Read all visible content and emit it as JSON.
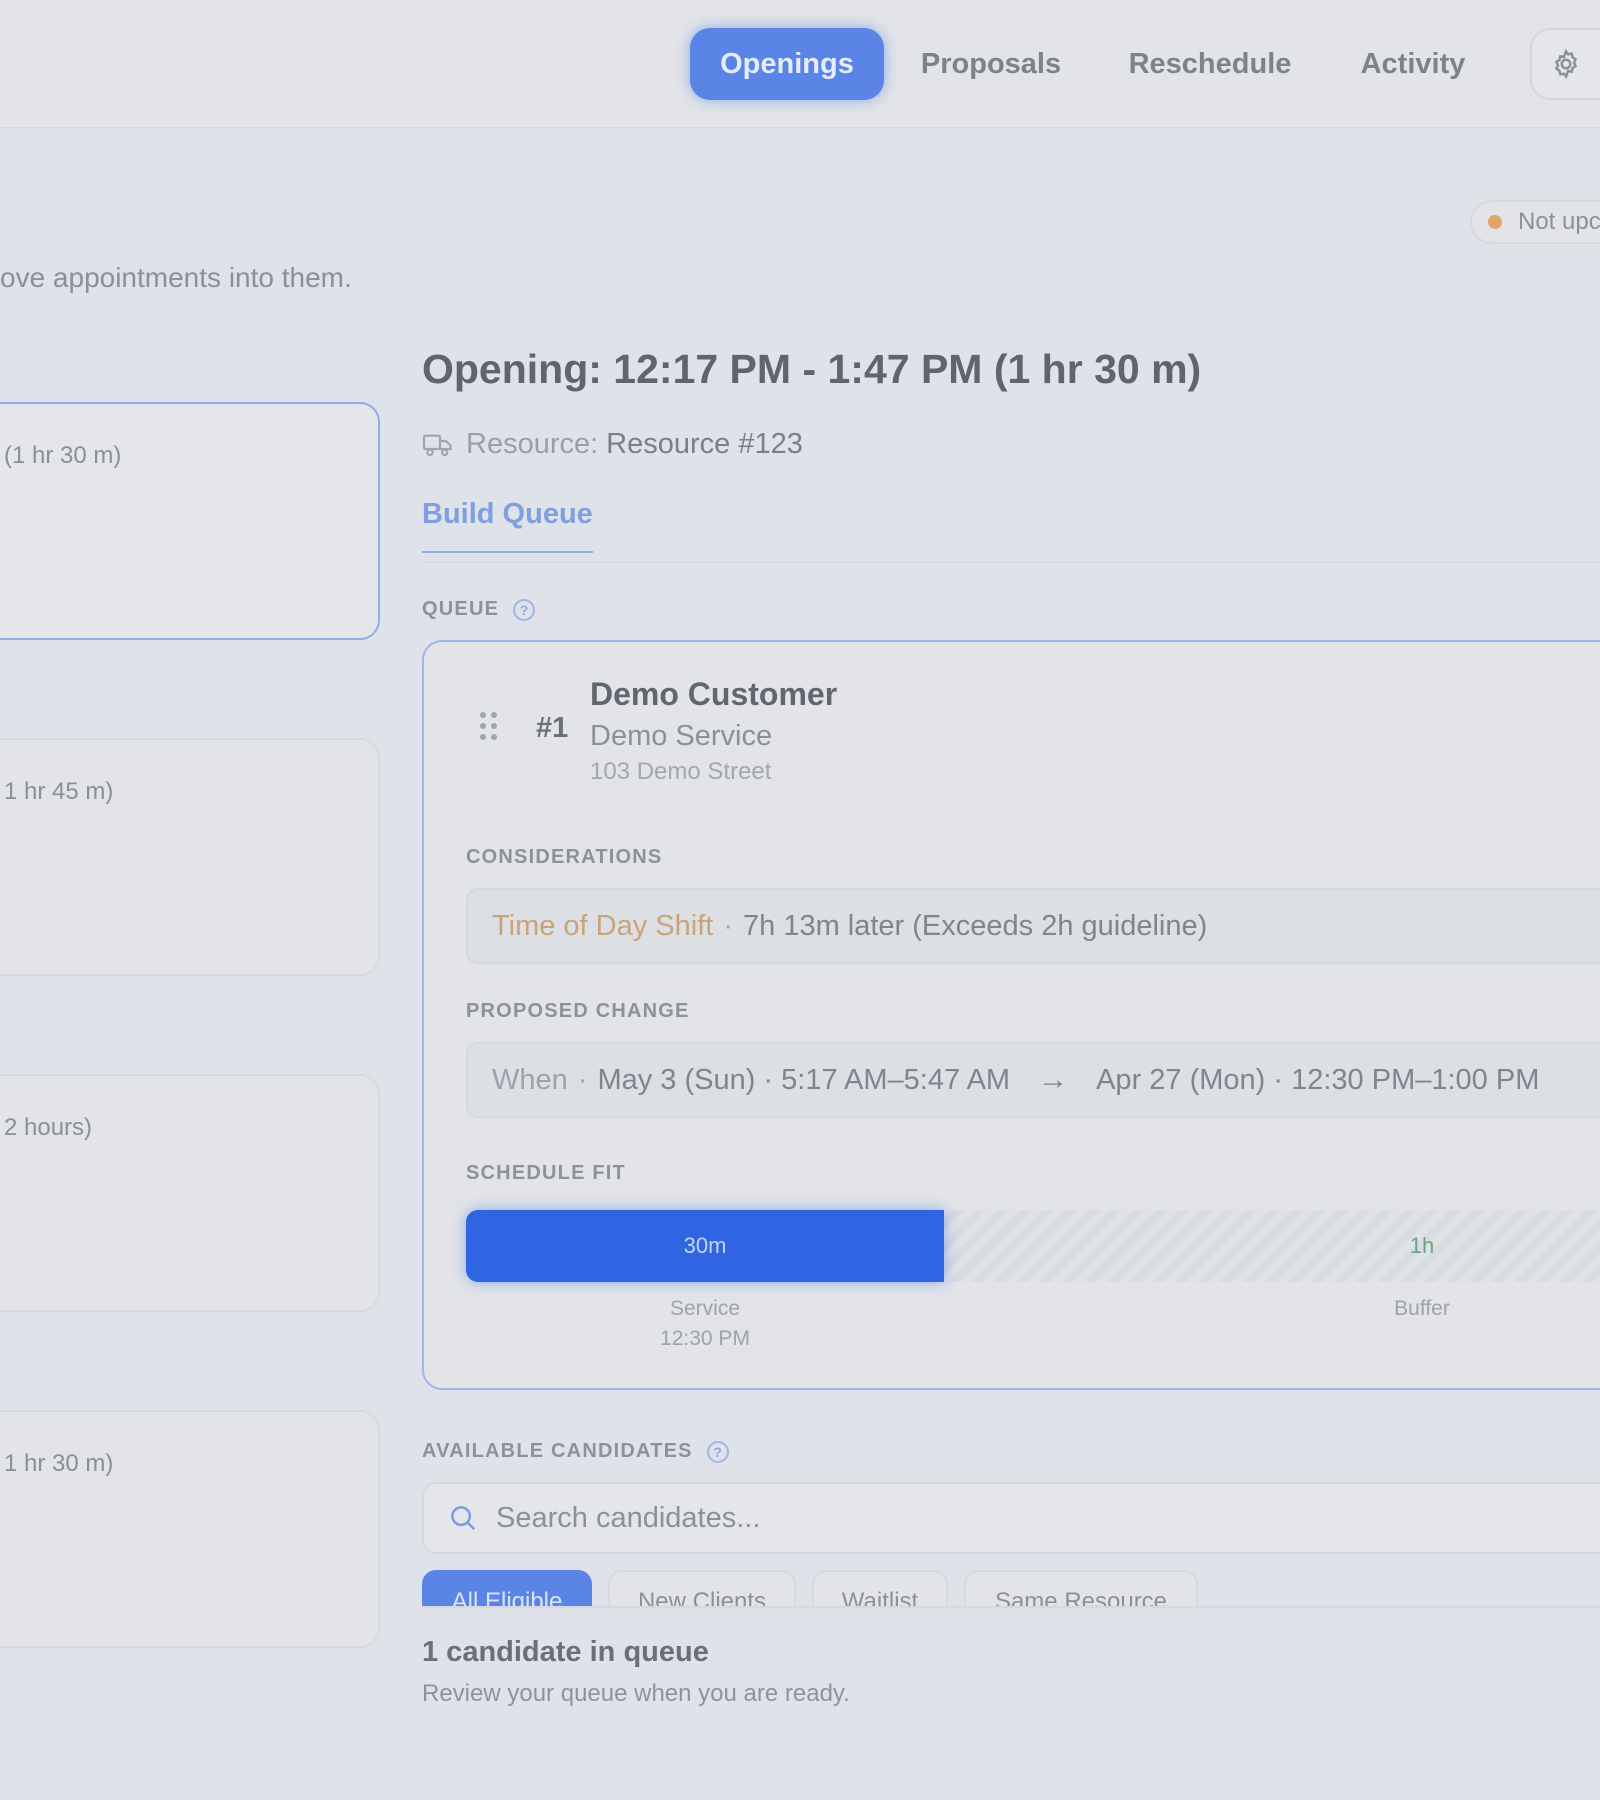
{
  "nav": {
    "tabs": [
      {
        "label": "Openings",
        "active": true
      },
      {
        "label": "Proposals",
        "active": false
      },
      {
        "label": "Reschedule",
        "active": false
      },
      {
        "label": "Activity",
        "active": false
      }
    ],
    "settings_icon": "gear-icon"
  },
  "status": {
    "label": "Not upc",
    "dot_color": "#e3a46a"
  },
  "page": {
    "subtitle": "ove appointments into them."
  },
  "openings_list": [
    {
      "duration": "(1 hr 30 m)",
      "selected": true
    },
    {
      "duration": "1 hr 45 m)",
      "selected": false
    },
    {
      "duration": "2 hours)",
      "selected": false
    },
    {
      "duration": "1 hr 30 m)",
      "selected": false
    }
  ],
  "detail": {
    "title": "Opening: 12:17 PM - 1:47 PM (1 hr 30 m)",
    "resource_icon": "truck-icon",
    "resource_label": "Resource:",
    "resource_value": "Resource #123",
    "tab": "Build Queue",
    "queue_label": "QUEUE",
    "queue_item": {
      "rank": "#1",
      "customer": "Demo Customer",
      "service": "Demo Service",
      "address": "103 Demo Street",
      "considerations_label": "CONSIDERATIONS",
      "consideration_tag": "Time of Day Shift",
      "consideration_sep": "·",
      "consideration_text": "7h 13m later (Exceeds 2h guideline)",
      "proposed_label": "PROPOSED CHANGE",
      "proposed_field": "When",
      "proposed_sep": "·",
      "proposed_from": "May 3 (Sun) · 5:17 AM–5:47 AM",
      "proposed_arrow": "→",
      "proposed_to": "Apr 27 (Mon) · 12:30 PM–1:00 PM",
      "fit_label": "SCHEDULE FIT",
      "fit": {
        "service_minutes": 30,
        "buffer_minutes": 60,
        "service_value": "30m",
        "buffer_value": "1h",
        "service_caption": "Service",
        "service_time": "12:30 PM",
        "buffer_caption": "Buffer"
      }
    }
  },
  "candidates": {
    "label": "AVAILABLE CANDIDATES",
    "search_placeholder": "Search candidates...",
    "filters": [
      {
        "label": "All Eligible",
        "active": true
      },
      {
        "label": "New Clients",
        "active": false
      },
      {
        "label": "Waitlist",
        "active": false
      },
      {
        "label": "Same Resource",
        "active": false
      }
    ]
  },
  "footer": {
    "title": "1 candidate in queue",
    "subtitle": "Review your queue when you are ready."
  },
  "colors": {
    "accent": "#2f65e3",
    "warning": "#c9a479",
    "buffer_text": "#6aa483"
  }
}
